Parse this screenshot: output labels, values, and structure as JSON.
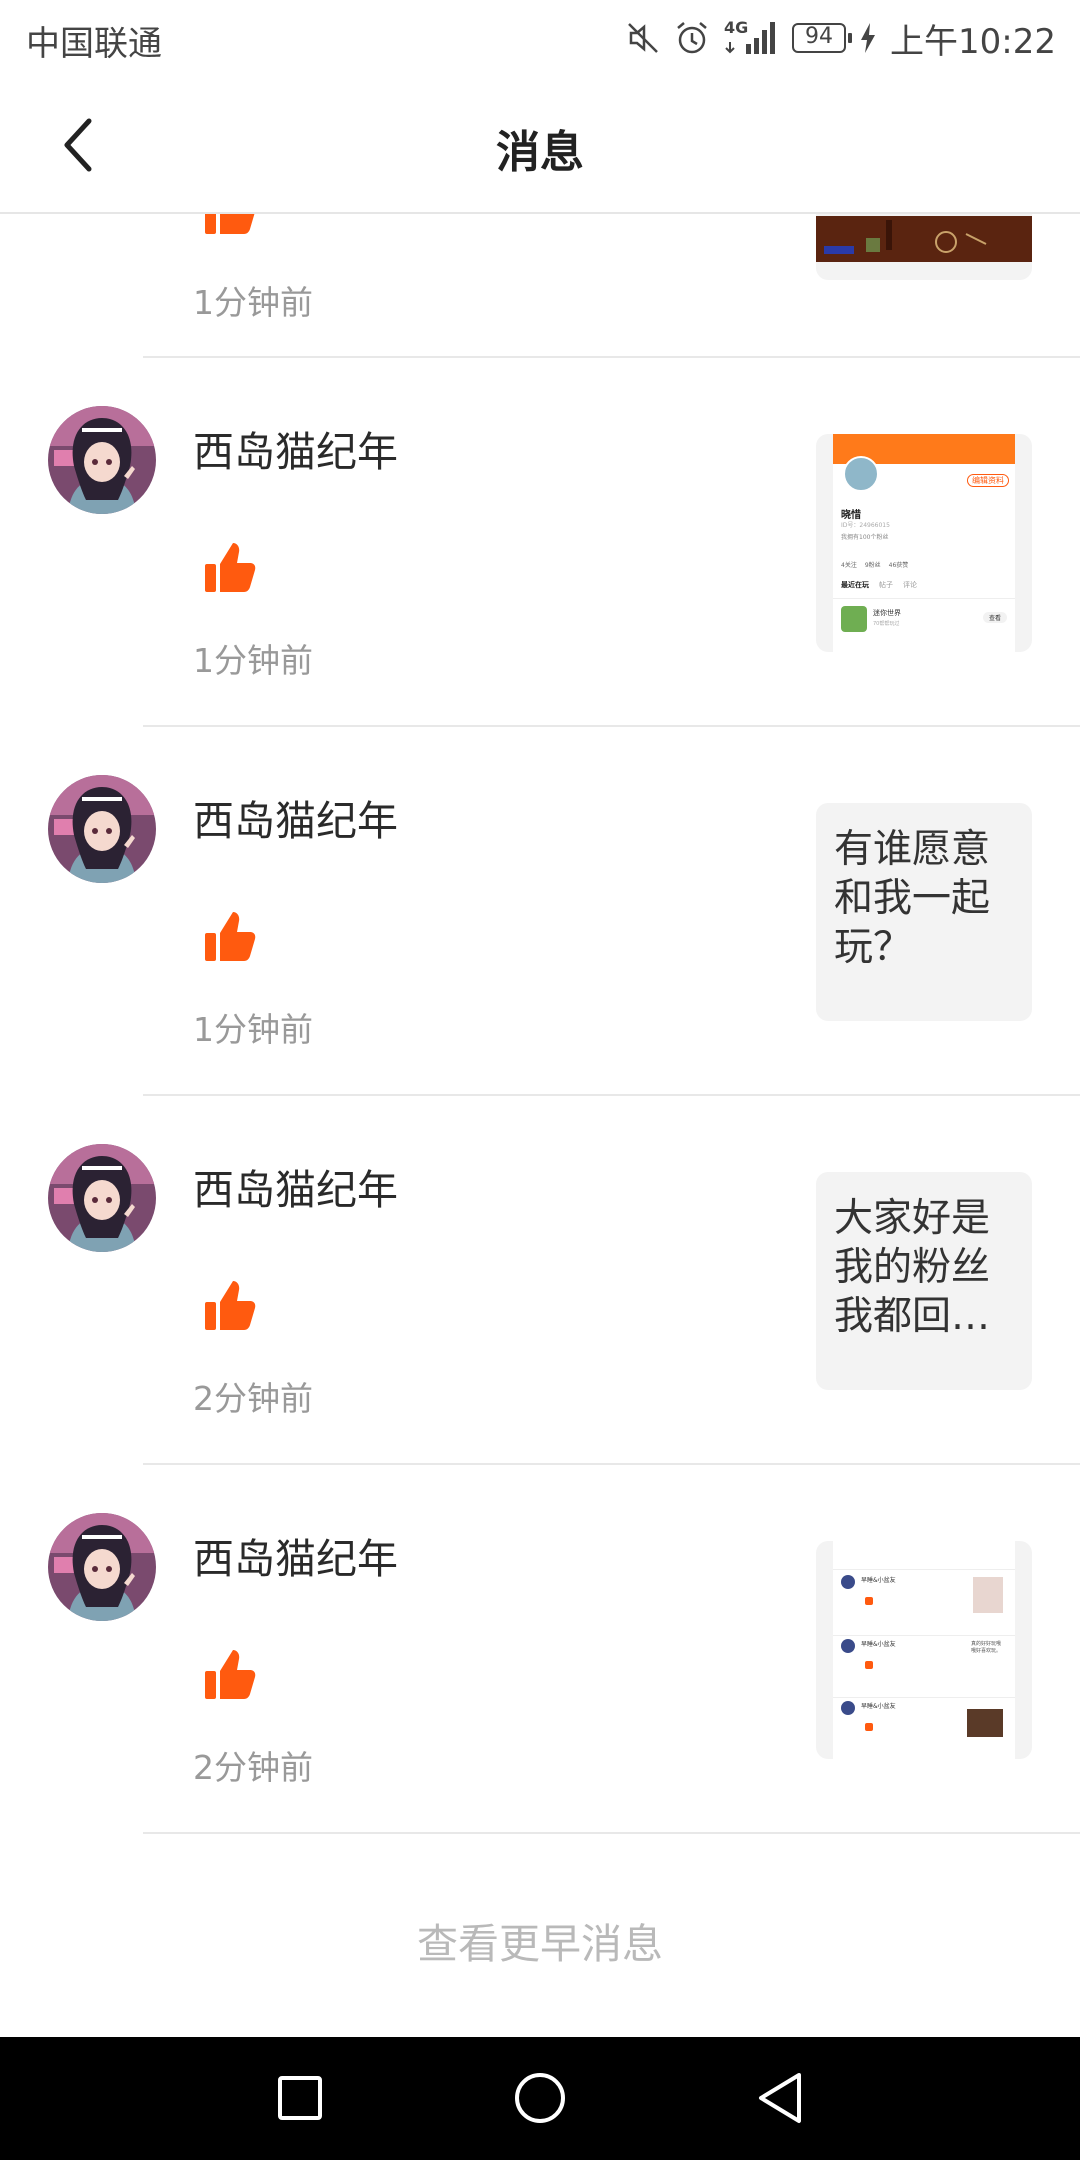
{
  "status_bar": {
    "carrier": "中国联通",
    "network": "4G",
    "battery": "94",
    "time": "上午10:22",
    "icons": [
      "mute-icon",
      "alarm-icon",
      "signal-icon",
      "battery-icon",
      "charging-icon"
    ]
  },
  "header": {
    "title": "消息",
    "back_icon": "chevron-left-icon"
  },
  "colors": {
    "accent": "#ff5a0f",
    "time_text": "#999999",
    "divider": "#e8e8e8",
    "thumb_bg": "#f3f3f3"
  },
  "messages": [
    {
      "user": "",
      "icon": "thumbs-up-icon",
      "time": "1分钟前",
      "preview_type": "image",
      "preview_text": ""
    },
    {
      "user": "西岛猫纪年",
      "icon": "thumbs-up-icon",
      "time": "1分钟前",
      "preview_type": "image",
      "preview_text": ""
    },
    {
      "user": "西岛猫纪年",
      "icon": "thumbs-up-icon",
      "time": "1分钟前",
      "preview_type": "text",
      "preview_text": "有谁愿意和我一起玩？"
    },
    {
      "user": "西岛猫纪年",
      "icon": "thumbs-up-icon",
      "time": "2分钟前",
      "preview_type": "text",
      "preview_text": "大家好是我的粉丝我都回…"
    },
    {
      "user": "西岛猫纪年",
      "icon": "thumbs-up-icon",
      "time": "2分钟前",
      "preview_type": "image",
      "preview_text": ""
    }
  ],
  "preview_profile": {
    "edit_label": "编辑资料",
    "name": "晓惜",
    "id_line": "ID号：24966015",
    "bio": "我拥有100个粉丝",
    "stats": [
      "4关注",
      "9粉丝",
      "46获赞"
    ],
    "tabs": [
      "最近在玩",
      "帖子",
      "评论"
    ],
    "game": "迷你世界",
    "game_sub": "70帮帮玩过",
    "game_btn": "查看"
  },
  "preview_comments": {
    "user": "早睡&小盆友",
    "reply": "真的好好玩哦哦好喜欢玩。"
  },
  "footer": {
    "more_label": "查看更早消息"
  },
  "nav_bar": {
    "recent_icon": "square-icon",
    "home_icon": "circle-icon",
    "back_icon": "triangle-back-icon"
  }
}
